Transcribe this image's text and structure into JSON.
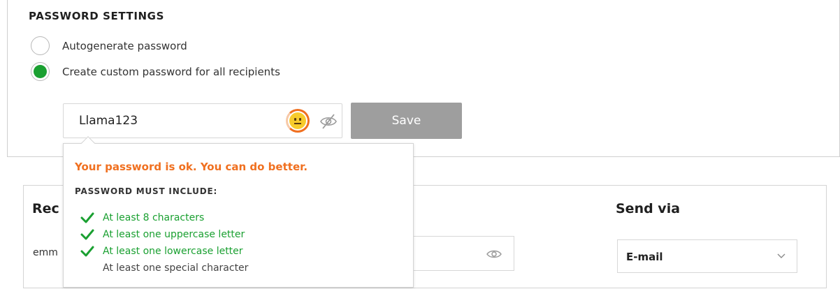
{
  "password_settings": {
    "title": "PASSWORD SETTINGS",
    "options": [
      {
        "label": "Autogenerate password",
        "selected": false
      },
      {
        "label": "Create custom password for all recipients",
        "selected": true
      }
    ],
    "password_value": "Llama123",
    "strength_icon": "neutral-face-icon",
    "visibility_icon": "eye-off-icon",
    "save_label": "Save"
  },
  "strength_popover": {
    "message": "Your password is ok. You can do better.",
    "rules_title": "PASSWORD MUST INCLUDE:",
    "rules": [
      {
        "text": "At least 8 characters",
        "met": true
      },
      {
        "text": "At least one uppercase letter",
        "met": true
      },
      {
        "text": "At least one lowercase letter",
        "met": true
      },
      {
        "text": "At least one special character",
        "met": false
      }
    ]
  },
  "recipients": {
    "heading": "Rec",
    "email_fragment": "emm",
    "send_via_heading": "Send via",
    "send_via_value": "E-mail"
  },
  "colors": {
    "accent_green": "#1aa031",
    "warning_orange": "#f07020",
    "save_disabled": "#9e9e9e"
  }
}
